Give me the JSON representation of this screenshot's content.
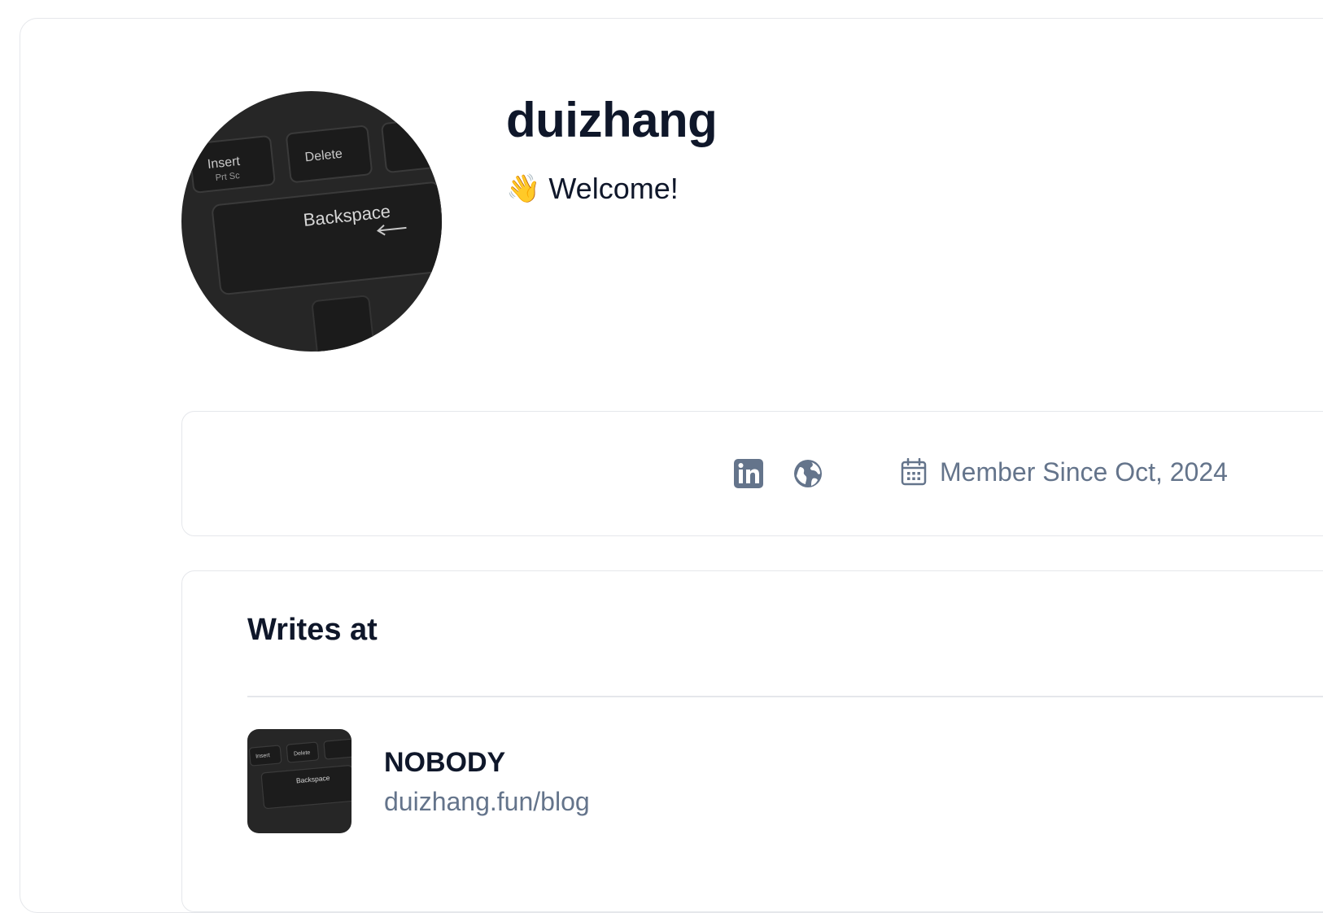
{
  "profile": {
    "username": "duizhang",
    "bio_emoji": "👋",
    "bio_text": "Welcome!"
  },
  "meta": {
    "icons": [
      "linkedin-icon",
      "globe-icon",
      "calendar-icon"
    ],
    "member_since": "Member Since Oct, 2024"
  },
  "writes": {
    "title": "Writes at",
    "blog": {
      "name": "NOBODY",
      "url": "duizhang.fun/blog"
    }
  },
  "colors": {
    "text_primary": "#0f172a",
    "text_muted": "#64748b",
    "border": "#e5e7eb"
  },
  "avatar_image": {
    "keys": [
      "Insert",
      "Prt Sc",
      "Delete",
      "Backspace"
    ]
  }
}
